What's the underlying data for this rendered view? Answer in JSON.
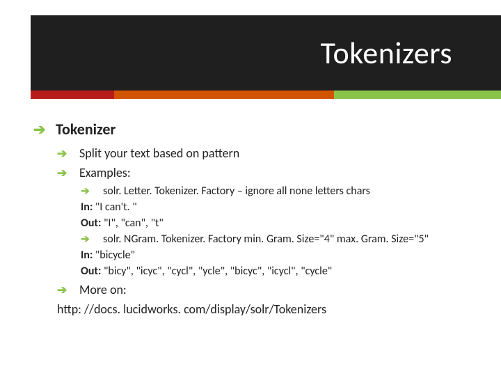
{
  "title": "Tokenizers",
  "lvl1": "Tokenizer",
  "lvl2_a": "Split your text based on pattern",
  "lvl2_b": "Examples:",
  "lvl3_a": "solr. Letter. Tokenizer. Factory – ignore all none letters chars",
  "ex1_in_label": "In:",
  "ex1_in": " \"I can't. \"",
  "ex1_out_label": "Out:",
  "ex1_out": " \"I\", \"can\", \"t\"",
  "lvl3_b": "solr. NGram. Tokenizer. Factory  min. Gram. Size=\"4\" max. Gram. Size=\"5\"",
  "ex2_in_label": "In:",
  "ex2_in": " \"bicycle\"",
  "ex2_out_label": "Out:",
  "ex2_out": " \"bicy\", \"icyc\", \"cycl\", \"ycle\", \"bicyc\", \"icycl\", \"cycle\"",
  "lvl2_c": "More on:",
  "link": "http: //docs. lucidworks. com/display/solr/Tokenizers"
}
